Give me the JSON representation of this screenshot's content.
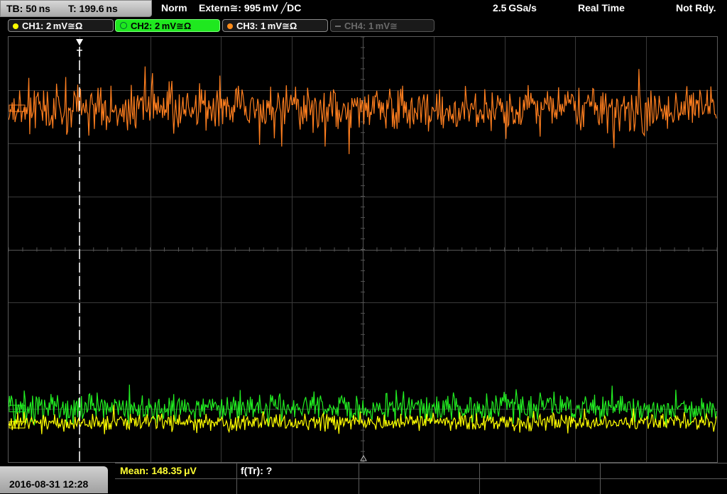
{
  "header": {
    "timebase": "TB: 50 ns",
    "trigger_time": "T: 199.6 ns",
    "trigger_mode": "Norm",
    "trigger_source": "Extern≅: 995 mV ╱DC",
    "sample_rate": "2.5 GSa/s",
    "acq_mode": "Real Time",
    "state": "Not Rdy."
  },
  "channels": [
    {
      "label": "CH1: 2 mV≅Ω",
      "color": "#ffff00",
      "active": false,
      "enabled": true
    },
    {
      "label": "CH2: 2 mV≅Ω",
      "color": "#00c000",
      "active": true,
      "enabled": true
    },
    {
      "label": "CH3: 1 mV≅Ω",
      "color": "#ff8c1a",
      "active": false,
      "enabled": true
    },
    {
      "label": "CH4: 1 mV≅",
      "color": "#6b6b6b",
      "active": false,
      "enabled": false
    }
  ],
  "trigger_marker": "T",
  "traces": {
    "ch1_color": "#ffff00",
    "ch2_color": "#22ee22",
    "ch3_color": "#ff7f1f"
  },
  "footer": {
    "datetime": "2016-08-31 12:28",
    "mean": "Mean: 148.35 μV",
    "ftr": "f(Tr): ?",
    "mean_color": "#ffff33"
  }
}
